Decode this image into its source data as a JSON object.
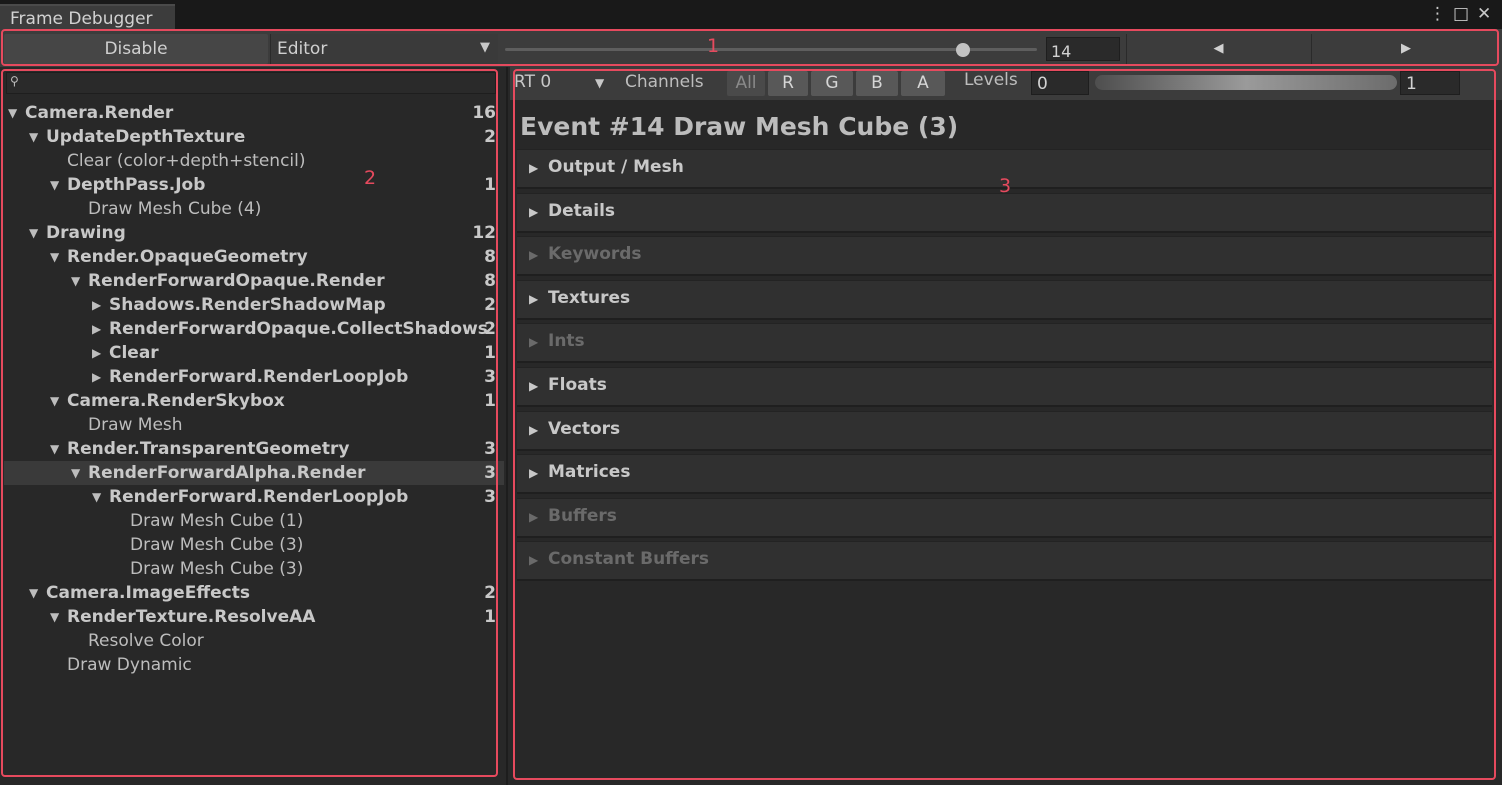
{
  "window": {
    "tab_title": "Frame Debugger",
    "menu_icon": "⋮",
    "maximize_icon": "□",
    "close_icon": "✕"
  },
  "toolbar": {
    "disable_label": "Disable",
    "target_select": "Editor",
    "slider_value_fraction": 0.86,
    "event_index": "14",
    "prev_icon": "◀",
    "next_icon": "▶"
  },
  "event_tree": {
    "search_placeholder": "",
    "rows": [
      {
        "label": "Camera.Render",
        "count": "16",
        "expanded": true,
        "bold": true
      },
      {
        "label": "UpdateDepthTexture",
        "count": "2",
        "expanded": true,
        "bold": true
      },
      {
        "label": "Clear (color+depth+stencil)",
        "count": "",
        "bold": false
      },
      {
        "label": "DepthPass.Job",
        "count": "1",
        "expanded": true,
        "bold": true
      },
      {
        "label": "Draw Mesh Cube (4)",
        "count": "",
        "bold": false
      },
      {
        "label": "Drawing",
        "count": "12",
        "expanded": true,
        "bold": true
      },
      {
        "label": "Render.OpaqueGeometry",
        "count": "8",
        "expanded": true,
        "bold": true
      },
      {
        "label": "RenderForwardOpaque.Render",
        "count": "8",
        "expanded": true,
        "bold": true
      },
      {
        "label": "Shadows.RenderShadowMap",
        "count": "2",
        "expanded": false,
        "bold": true
      },
      {
        "label": "RenderForwardOpaque.CollectShadows",
        "count": "2",
        "expanded": false,
        "bold": true
      },
      {
        "label": "Clear",
        "count": "1",
        "expanded": false,
        "bold": true
      },
      {
        "label": "RenderForward.RenderLoopJob",
        "count": "3",
        "expanded": false,
        "bold": true
      },
      {
        "label": "Camera.RenderSkybox",
        "count": "1",
        "expanded": true,
        "bold": true
      },
      {
        "label": "Draw Mesh",
        "count": "",
        "bold": false
      },
      {
        "label": "Render.TransparentGeometry",
        "count": "3",
        "expanded": true,
        "bold": true
      },
      {
        "label": "RenderForwardAlpha.Render",
        "count": "3",
        "expanded": true,
        "bold": true
      },
      {
        "label": "RenderForward.RenderLoopJob",
        "count": "3",
        "expanded": true,
        "bold": true
      },
      {
        "label": "Draw Mesh Cube (1)",
        "count": "",
        "bold": false
      },
      {
        "label": "Draw Mesh Cube (3)",
        "count": "",
        "bold": false
      },
      {
        "label": "Draw Mesh Cube (3)",
        "count": "",
        "bold": false
      },
      {
        "label": "Camera.ImageEffects",
        "count": "2",
        "expanded": true,
        "bold": true
      },
      {
        "label": "RenderTexture.ResolveAA",
        "count": "1",
        "expanded": true,
        "bold": true
      },
      {
        "label": "Resolve Color",
        "count": "",
        "bold": false
      },
      {
        "label": "Draw Dynamic",
        "count": "",
        "bold": false
      }
    ]
  },
  "details": {
    "rt_select": "RT 0",
    "channels_label": "Channels",
    "channels": [
      "All",
      "R",
      "G",
      "B",
      "A"
    ],
    "levels_label": "Levels",
    "level_min": "0",
    "level_max": "1",
    "event_title": "Event #14 Draw Mesh Cube (3)",
    "sections": [
      {
        "label": "Output / Mesh",
        "enabled": true
      },
      {
        "label": "Details",
        "enabled": true
      },
      {
        "label": "Keywords",
        "enabled": false
      },
      {
        "label": "Textures",
        "enabled": true
      },
      {
        "label": "Ints",
        "enabled": false
      },
      {
        "label": "Floats",
        "enabled": true
      },
      {
        "label": "Vectors",
        "enabled": true
      },
      {
        "label": "Matrices",
        "enabled": true
      },
      {
        "label": "Buffers",
        "enabled": false
      },
      {
        "label": "Constant Buffers",
        "enabled": false
      }
    ]
  },
  "annotations": {
    "label_1": "1",
    "label_2": "2",
    "label_3": "3",
    "color": "#e64a5e"
  }
}
